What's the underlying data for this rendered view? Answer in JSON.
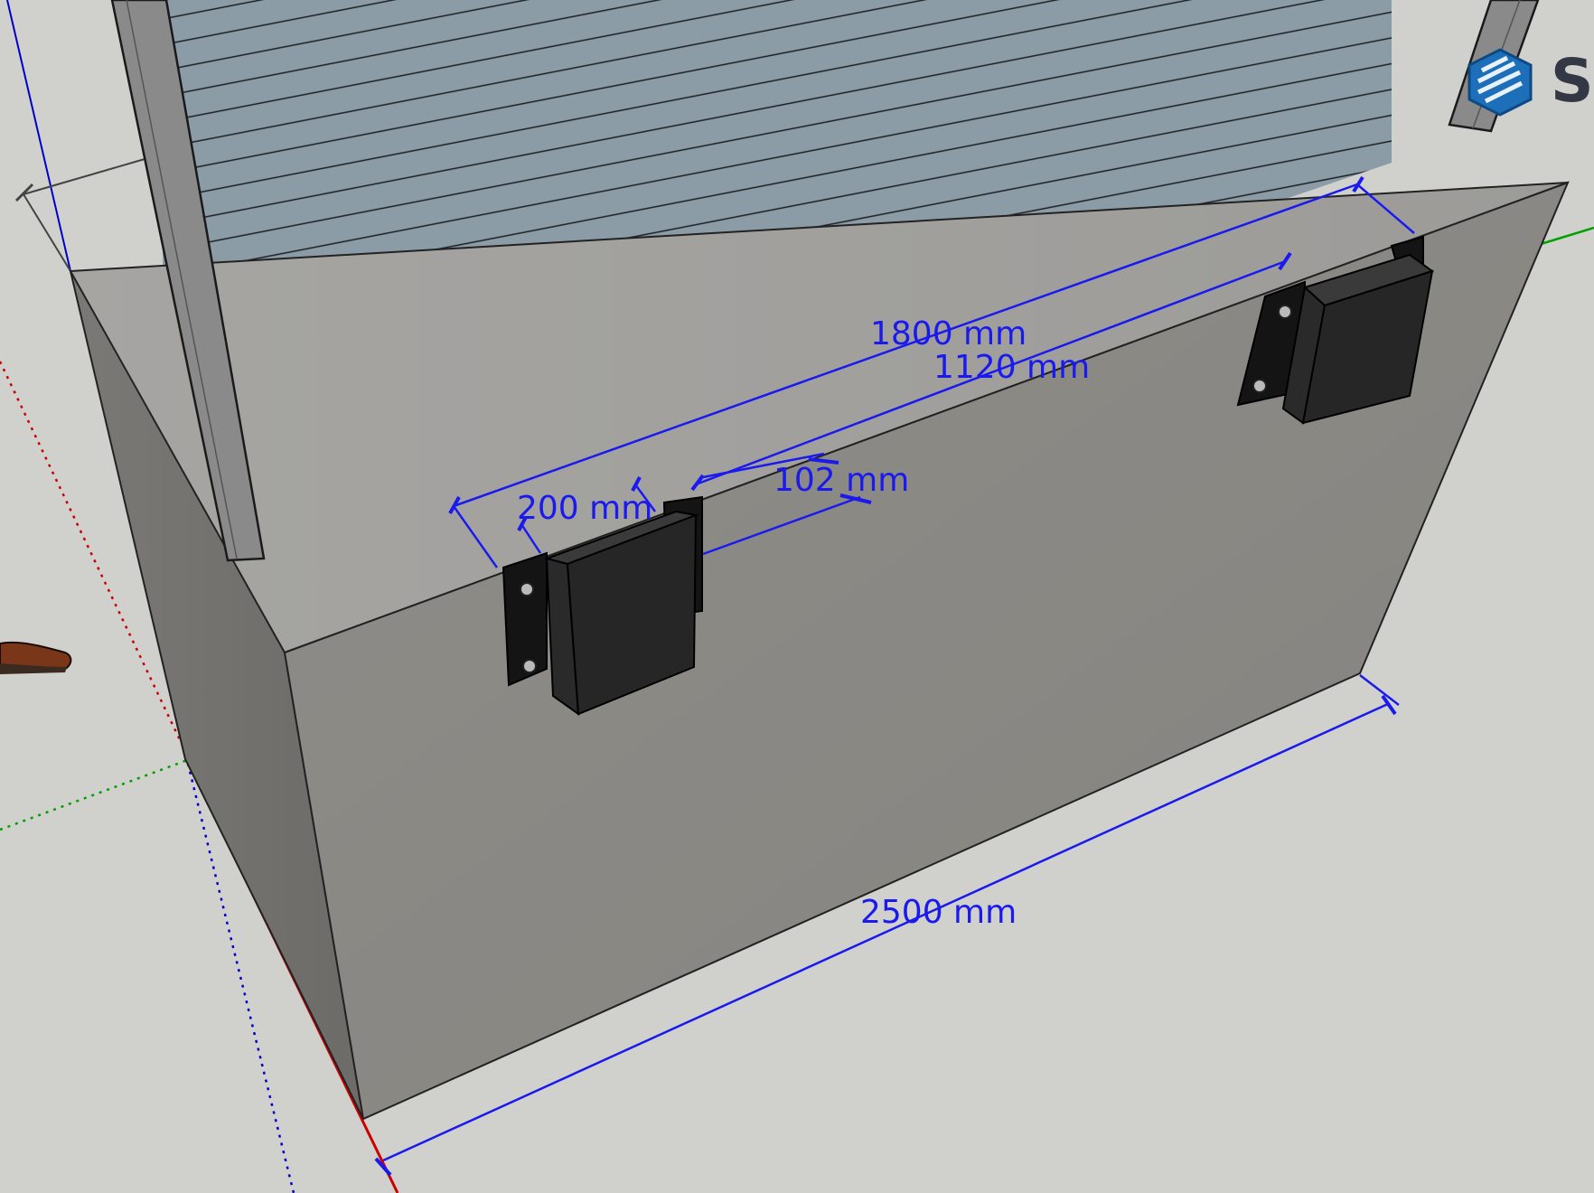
{
  "app": {
    "logo_text": "Sk",
    "logo_icon": "sketchup-logo-icon"
  },
  "colors": {
    "background": "#d0d0cc",
    "dimension": "#1a1aee",
    "concrete": "#8e8c88",
    "shutter": "#8a9aa4",
    "bumper": "#1e1e1e",
    "axis_red": "#cc0000",
    "axis_green": "#00a000",
    "axis_blue": "#0000cc"
  },
  "dimensions": {
    "dock_width": "2500 mm",
    "bumper_spacing_outer": "1800 mm",
    "bumper_spacing_inner": "1120 mm",
    "bumper_width": "200 mm",
    "bumper_depth": "102 mm"
  }
}
